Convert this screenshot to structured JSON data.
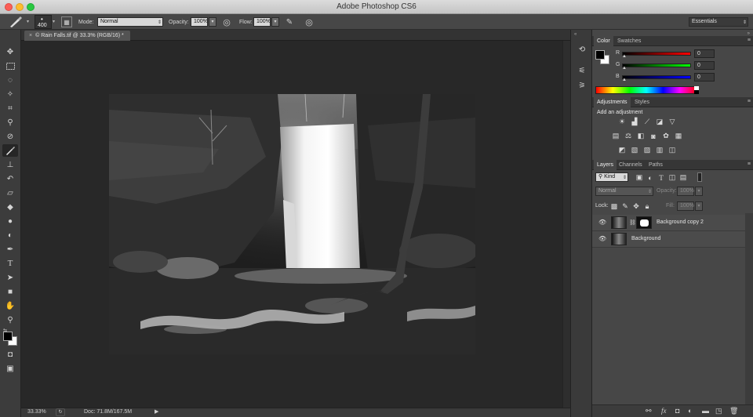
{
  "window": {
    "title": "Adobe Photoshop CS6"
  },
  "options_bar": {
    "brush_size": "400",
    "mode_label": "Mode:",
    "mode_value": "Normal",
    "opacity_label": "Opacity:",
    "opacity_value": "100%",
    "flow_label": "Flow:",
    "flow_value": "100%",
    "workspace_value": "Essentials"
  },
  "document": {
    "tab_title": "© Rain Falls.tif @ 33.3% (RGB/16) *",
    "zoom": "33.33%",
    "doc_info": "Doc: 71.8M/167.5M"
  },
  "color_panel": {
    "tabs": [
      "Color",
      "Swatches"
    ],
    "channels": [
      {
        "label": "R",
        "value": "0",
        "color": "#ff2020"
      },
      {
        "label": "G",
        "value": "0",
        "color": "#20ff20"
      },
      {
        "label": "B",
        "value": "0",
        "color": "#2040ff"
      }
    ]
  },
  "adjustments_panel": {
    "tabs": [
      "Adjustments",
      "Styles"
    ],
    "heading": "Add an adjustment"
  },
  "layers_panel": {
    "tabs": [
      "Layers",
      "Channels",
      "Paths"
    ],
    "filter_value": "Kind",
    "blend_value": "Normal",
    "opacity_label": "Opacity:",
    "opacity_value": "100%",
    "lock_label": "Lock:",
    "fill_label": "Fill:",
    "fill_value": "100%",
    "layers": [
      {
        "name": "Background copy 2"
      },
      {
        "name": "Background"
      }
    ]
  },
  "colors": {
    "accent": "#474747",
    "canvas_bg": "#282828"
  }
}
